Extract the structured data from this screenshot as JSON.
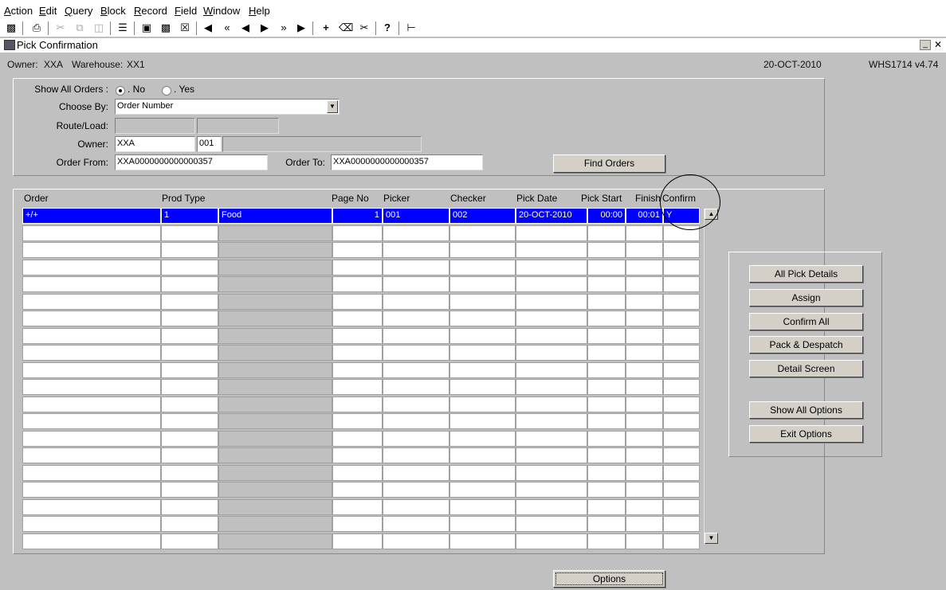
{
  "menu": [
    "Action",
    "Edit",
    "Query",
    "Block",
    "Record",
    "Field",
    "Window",
    "Help"
  ],
  "toolbar": {
    "icons": [
      "save-icon",
      "print-icon",
      "cut-icon",
      "copy-icon",
      "paste-icon",
      "list-icon",
      "query-icon",
      "execute-icon",
      "cancel-query-icon",
      "first-record-icon",
      "prev-set-icon",
      "prev-record-icon",
      "next-record-icon",
      "next-set-icon",
      "last-record-icon",
      "insert-record-icon",
      "delete-record-icon",
      "clear-record-icon",
      "help-icon",
      "exit-icon"
    ]
  },
  "window": {
    "title": "Pick Confirmation"
  },
  "header": {
    "owner_label": "Owner:",
    "owner_value": "XXA",
    "warehouse_label": "Warehouse:",
    "warehouse_value": "XX1",
    "date": "20-OCT-2010",
    "version": "WHS1714 v4.74"
  },
  "criteria": {
    "show_all_label": "Show All Orders :",
    "opt_no": ". No",
    "opt_yes": ". Yes",
    "selected": "No",
    "choose_by_label": "Choose By:",
    "choose_by_value": "Order Number",
    "route_label": "Route/Load:",
    "route_value": "",
    "load_value": "",
    "owner_label": "Owner:",
    "owner_code": "XXA",
    "owner_num": "001",
    "owner_desc": "",
    "order_from_label": "Order From:",
    "order_from_value": "XXA0000000000000357",
    "order_to_label": "Order To:",
    "order_to_value": "XXA0000000000000357",
    "find_button": "Find Orders"
  },
  "grid": {
    "columns": [
      "Order",
      "Prod Type",
      "",
      "Page No",
      "Picker",
      "Checker",
      "Pick Date",
      "Pick Start",
      "Finish",
      "Confirm"
    ],
    "rows": [
      [
        "+/+",
        "1",
        "Food",
        "1",
        "001",
        "002",
        "20-OCT-2010",
        "00:00",
        "00:01",
        "Y"
      ]
    ],
    "empty_rows": 19
  },
  "actions": {
    "all_pick_details": "All Pick Details",
    "assign": "Assign",
    "confirm_all": "Confirm All",
    "pack_despatch": "Pack & Despatch",
    "detail_screen": "Detail Screen",
    "show_all_options": "Show All Options",
    "exit_options": "Exit Options"
  },
  "footer": {
    "options_button": "Options"
  }
}
